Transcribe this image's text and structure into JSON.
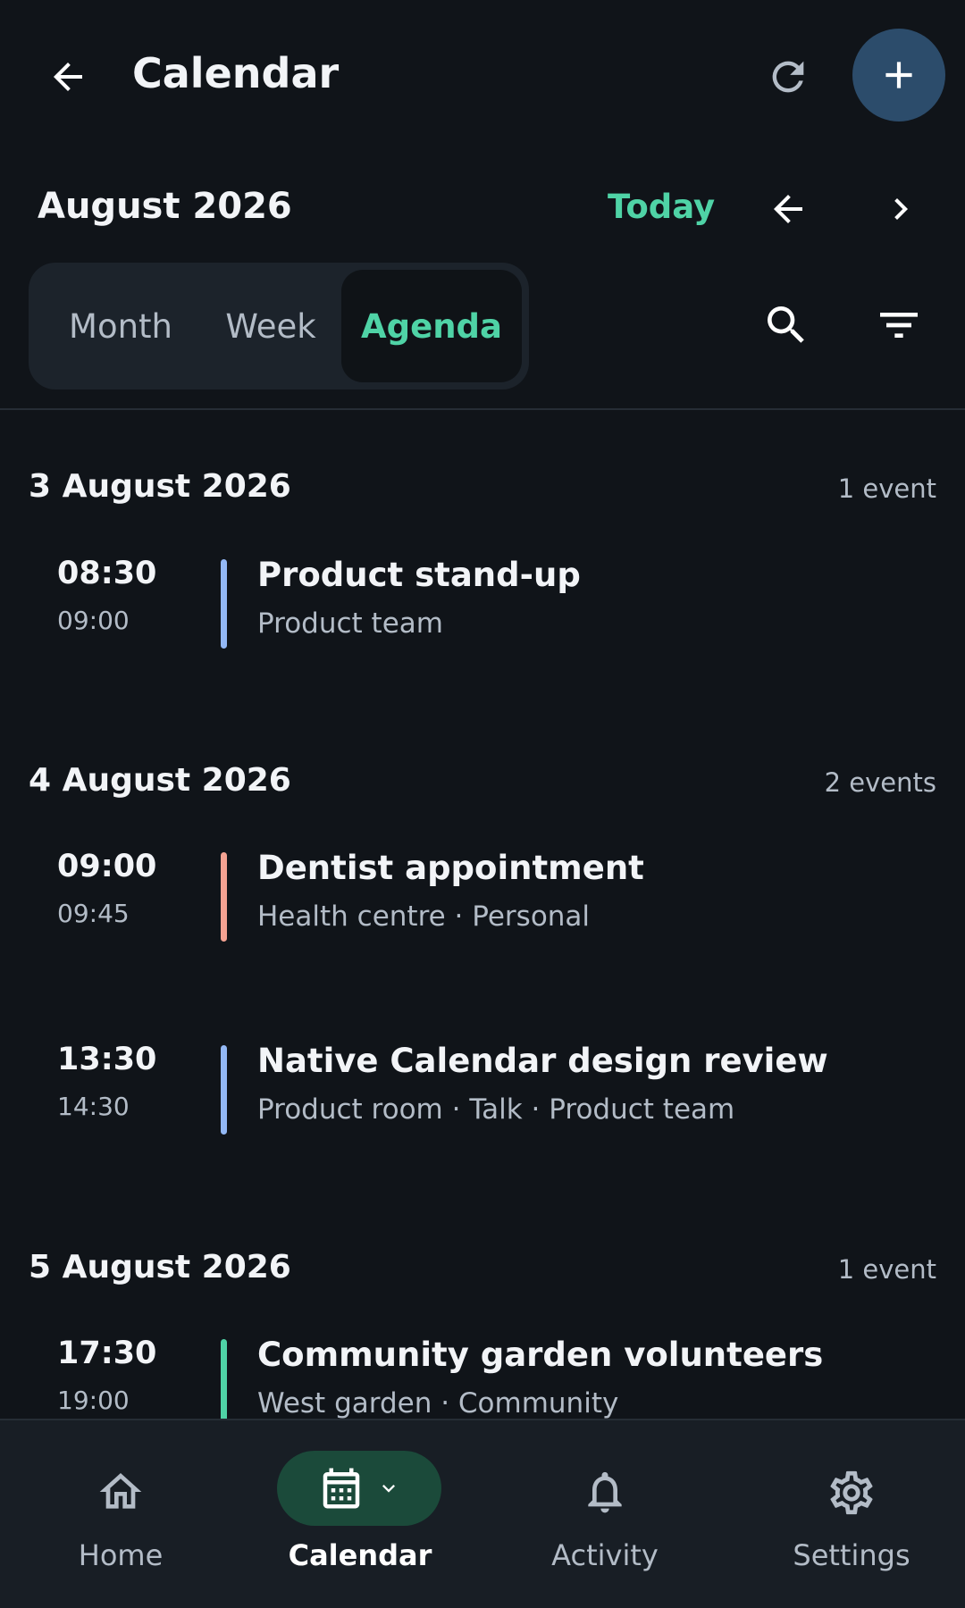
{
  "header": {
    "title": "Calendar"
  },
  "month_nav": {
    "month_label": "August 2026",
    "today_label": "Today"
  },
  "view_switch": {
    "options": [
      "Month",
      "Week",
      "Agenda"
    ],
    "selected": "Agenda"
  },
  "agenda": {
    "days": [
      {
        "date": "3 August 2026",
        "count": "1 event",
        "events": [
          {
            "start": "08:30",
            "end": "09:00",
            "title": "Product stand-up",
            "subtitle": "Product team",
            "color": "#93b8f5"
          }
        ]
      },
      {
        "date": "4 August 2026",
        "count": "2 events",
        "events": [
          {
            "start": "09:00",
            "end": "09:45",
            "title": "Dentist appointment",
            "subtitle": "Health centre · Personal",
            "color": "#f4a292"
          },
          {
            "start": "13:30",
            "end": "14:30",
            "title": "Native Calendar design review",
            "subtitle": "Product room · Talk · Product team",
            "color": "#93b8f5"
          }
        ]
      },
      {
        "date": "5 August 2026",
        "count": "1 event",
        "events": [
          {
            "start": "17:30",
            "end": "19:00",
            "title": "Community garden volunteers",
            "subtitle": "West garden · Community",
            "color": "#4fd3a6"
          }
        ]
      }
    ]
  },
  "bottom_nav": {
    "items": [
      {
        "label": "Home",
        "icon": "home-icon"
      },
      {
        "label": "Calendar",
        "icon": "calendar-icon",
        "active": true
      },
      {
        "label": "Activity",
        "icon": "bell-icon"
      },
      {
        "label": "Settings",
        "icon": "gear-icon"
      }
    ]
  },
  "colors": {
    "background": "#101419",
    "accent": "#4fd3a6",
    "fab": "#2c4c6b",
    "active_nav_pill": "#1b4a3a"
  }
}
